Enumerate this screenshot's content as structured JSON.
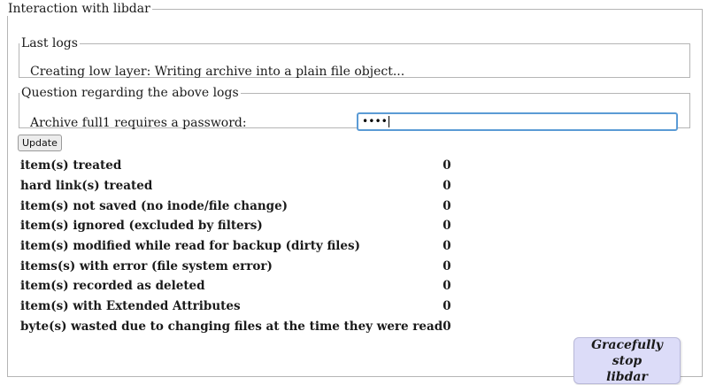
{
  "interaction": {
    "legend": "Interaction with libdar"
  },
  "last_logs": {
    "legend": "Last logs",
    "message": "Creating low layer: Writing archive into a plain file object..."
  },
  "question": {
    "legend": "Question regarding the above logs",
    "prompt": "Archive full1 requires a password:",
    "password_masked": "••••"
  },
  "update_button": "Update",
  "stats": [
    {
      "label": "item(s) treated",
      "value": "0"
    },
    {
      "label": "hard link(s) treated",
      "value": "0"
    },
    {
      "label": "item(s) not saved (no inode/file change)",
      "value": "0"
    },
    {
      "label": "item(s) ignored (excluded by filters)",
      "value": "0"
    },
    {
      "label": "item(s) modified while read for backup (dirty files)",
      "value": "0"
    },
    {
      "label": "items(s) with error (file system error)",
      "value": "0"
    },
    {
      "label": "item(s) recorded as deleted",
      "value": "0"
    },
    {
      "label": "item(s) with Extended Attributes",
      "value": "0"
    },
    {
      "label": "byte(s) wasted due to changing files at the time they were read",
      "value": "0"
    }
  ],
  "stop_button": {
    "line1": "Gracefully stop",
    "line2": "libdar"
  },
  "colors": {
    "input_focus_border": "#5b9bd5",
    "stop_button_bg": "#dcdcf8"
  }
}
